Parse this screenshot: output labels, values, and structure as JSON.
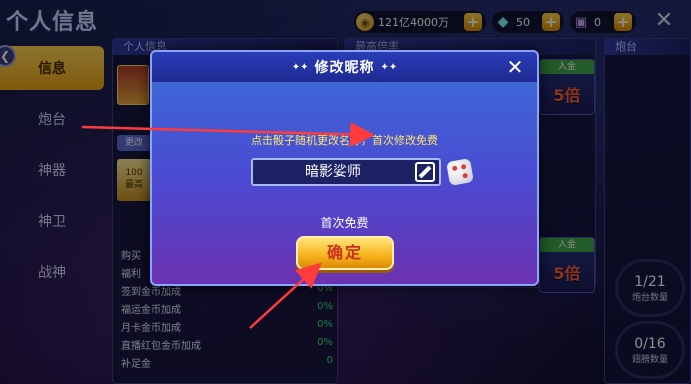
{
  "page_title": "个人信息",
  "currencies": [
    {
      "icon": "gold-coin-icon",
      "value": "121亿4000万"
    },
    {
      "icon": "diamond-icon",
      "value": "50"
    },
    {
      "icon": "card-icon",
      "value": "0"
    }
  ],
  "nav_items": [
    {
      "label": "信息",
      "active": true
    },
    {
      "label": "炮台",
      "active": false
    },
    {
      "label": "神器",
      "active": false
    },
    {
      "label": "神卫",
      "active": false
    },
    {
      "label": "战神",
      "active": false
    }
  ],
  "panels": {
    "info_head": "个人信息",
    "mult_head": "最高倍率",
    "cannon_head": "炮台",
    "edit_label": "更改",
    "level_text": "100",
    "level_sub": "最高"
  },
  "stats": [
    {
      "label": "购买",
      "value": ""
    },
    {
      "label": "福利",
      "value": ""
    },
    {
      "label": "签到金币加成",
      "value": "0%"
    },
    {
      "label": "福运金币加成",
      "value": "0%"
    },
    {
      "label": "月卡金币加成",
      "value": "0%"
    },
    {
      "label": "直播红包金币加成",
      "value": "0%"
    },
    {
      "label": "补足金",
      "value": "0"
    }
  ],
  "mult_cards": [
    {
      "tag": "入金",
      "num": "5倍"
    },
    {
      "tag": "入金",
      "num": "5倍"
    }
  ],
  "counts": [
    {
      "value": "1/21",
      "label": "炮台数量"
    },
    {
      "value": "0/16",
      "label": "翅膀数量"
    }
  ],
  "dialog": {
    "title": "修改昵称",
    "hint": "点击骰子随机更改名称，首次修改免费",
    "nickname": "暗影娑师",
    "free_label": "首次免费",
    "confirm_label": "确定"
  },
  "colors": {
    "accent_gold": "#f6b21a",
    "dialog_blue": "#3a6fd8",
    "hint_yellow": "#ffe46a",
    "arrow_red": "#ff3b3b"
  }
}
